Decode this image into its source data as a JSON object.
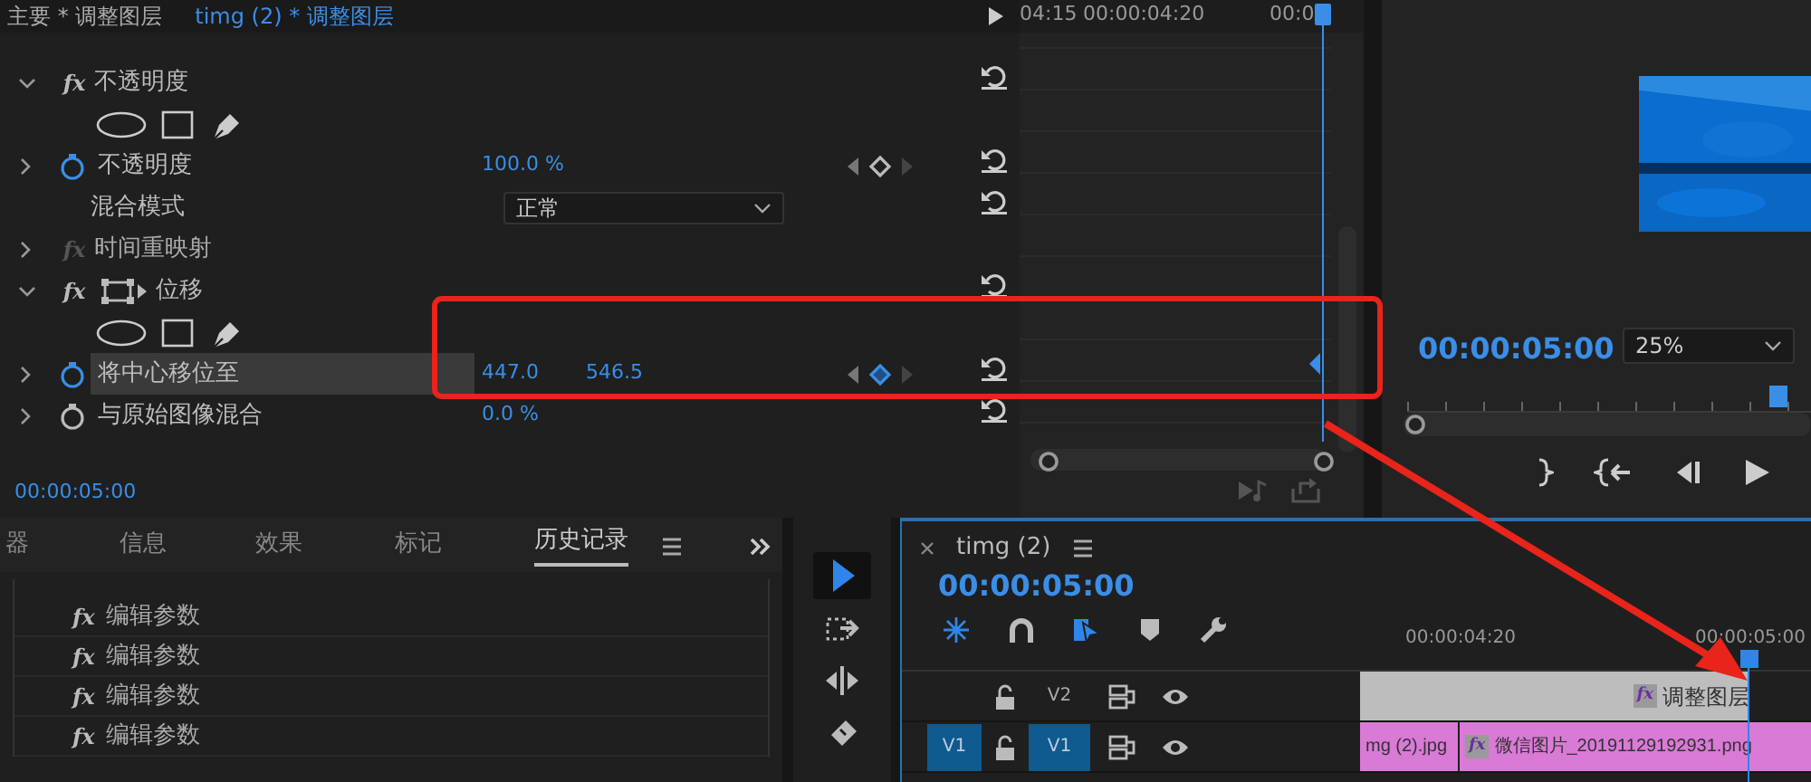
{
  "panel_tabs": [
    {
      "label": "主要 * 调整图层",
      "selected": false
    },
    {
      "label": "timg (2) * 调整图层",
      "selected": true
    }
  ],
  "effect_rows": [
    {
      "kind": "group",
      "expanded": true,
      "enabled": true,
      "icon_text": "fx",
      "label": "不透明度",
      "transform_icon": false
    },
    {
      "kind": "masks"
    },
    {
      "kind": "param",
      "label": "不透明度",
      "animated": true,
      "highlighted": false,
      "values": [
        "100.0 %"
      ],
      "keyframe_nav": true,
      "on_keyframe": false
    },
    {
      "kind": "select",
      "label": "混合模式",
      "value": "正常"
    },
    {
      "kind": "group",
      "expanded": false,
      "enabled": false,
      "icon_text": "fx",
      "label": "时间重映射",
      "transform_icon": false
    },
    {
      "kind": "group",
      "expanded": true,
      "enabled": true,
      "icon_text": "fx",
      "label": "位移",
      "transform_icon": true
    },
    {
      "kind": "masks"
    },
    {
      "kind": "param",
      "label": "将中心移位至",
      "animated": true,
      "highlighted": true,
      "values": [
        "447.0",
        "546.5"
      ],
      "keyframe_nav": true,
      "on_keyframe": true
    },
    {
      "kind": "param",
      "label": "与原始图像混合",
      "animated": false,
      "highlighted": false,
      "values": [
        "0.0 %"
      ],
      "keyframe_nav": false
    }
  ],
  "effect_timecode": "00:00:05:00",
  "keyframe_ruler": [
    "04:15",
    "00:00:04:20",
    "00:0"
  ],
  "program": {
    "timecode": "00:00:05:00",
    "zoom": "25%"
  },
  "history": {
    "tabs": [
      {
        "label": "器",
        "selected": false
      },
      {
        "label": "信息",
        "selected": false
      },
      {
        "label": "效果",
        "selected": false
      },
      {
        "label": "标记",
        "selected": false
      },
      {
        "label": "历史记录",
        "selected": true
      }
    ],
    "items": [
      {
        "icon_text": "fx",
        "label": "编辑参数"
      },
      {
        "icon_text": "fx",
        "label": "编辑参数"
      },
      {
        "icon_text": "fx",
        "label": "编辑参数"
      },
      {
        "icon_text": "fx",
        "label": "编辑参数"
      }
    ]
  },
  "tools": [
    {
      "kind": "select",
      "selected": true
    },
    {
      "kind": "track-select",
      "selected": false
    },
    {
      "kind": "ripple",
      "selected": false
    },
    {
      "kind": "razor",
      "selected": false
    }
  ],
  "timeline": {
    "title": "timg (2)",
    "timecode": "00:00:05:00",
    "ruler": [
      "00:00:04:20",
      "00:00:05:00"
    ],
    "tracks": [
      {
        "label": "V2",
        "targeted": false,
        "clips": [
          {
            "kind": "adjustment",
            "icon_text": "fx",
            "label": "调整图层"
          }
        ]
      },
      {
        "label": "V1",
        "source_patch": "V1",
        "targeted": true,
        "clips": [
          {
            "label": "mg (2).jpg"
          },
          {
            "icon_text": "fx",
            "label": "微信图片_20191129192931.png"
          }
        ]
      }
    ]
  },
  "annotation": {
    "box": true,
    "arrow": true
  }
}
